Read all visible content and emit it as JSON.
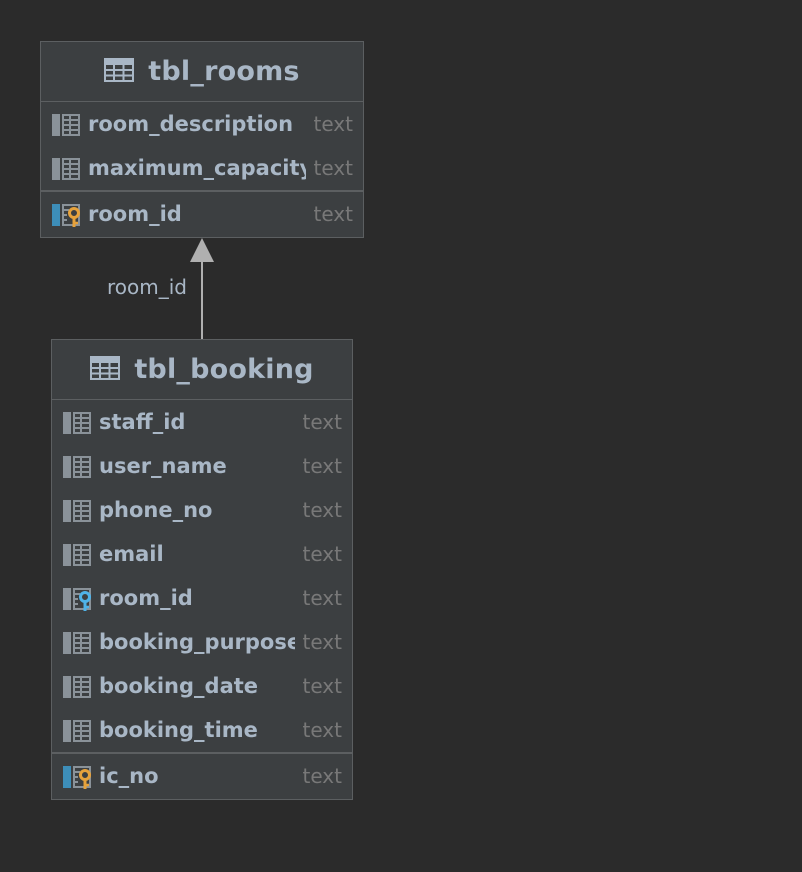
{
  "tables": [
    {
      "id": "rooms",
      "name": "tbl_rooms",
      "columns": [
        {
          "name": "room_description",
          "type": "text",
          "icon": "column-icon"
        },
        {
          "name": "maximum_capacity",
          "type": "text",
          "icon": "column-icon"
        }
      ],
      "primary_key": [
        {
          "name": "room_id",
          "type": "text",
          "icon": "primary-key-icon"
        }
      ]
    },
    {
      "id": "booking",
      "name": "tbl_booking",
      "columns": [
        {
          "name": "staff_id",
          "type": "text",
          "icon": "column-icon"
        },
        {
          "name": "user_name",
          "type": "text",
          "icon": "column-icon"
        },
        {
          "name": "phone_no",
          "type": "text",
          "icon": "column-icon"
        },
        {
          "name": "email",
          "type": "text",
          "icon": "column-icon"
        },
        {
          "name": "room_id",
          "type": "text",
          "icon": "foreign-key-icon"
        },
        {
          "name": "booking_purpose",
          "type": "text",
          "icon": "column-icon"
        },
        {
          "name": "booking_date",
          "type": "text",
          "icon": "column-icon"
        },
        {
          "name": "booking_time",
          "type": "text",
          "icon": "column-icon"
        }
      ],
      "primary_key": [
        {
          "name": "ic_no",
          "type": "text",
          "icon": "primary-key-icon"
        }
      ]
    }
  ],
  "relations": [
    {
      "from": "tbl_booking",
      "to": "tbl_rooms",
      "label": "room_id"
    }
  ],
  "colors": {
    "background": "#2b2b2b",
    "entity_bg": "#3c3f41",
    "border": "#5c5f61",
    "text": "#a9b7c6",
    "type_text": "#787878",
    "primary_key": "#e6a23c",
    "foreign_key": "#4fb3e8",
    "pk_bar": "#3d8eb9",
    "arrow": "#b0b0b0"
  }
}
